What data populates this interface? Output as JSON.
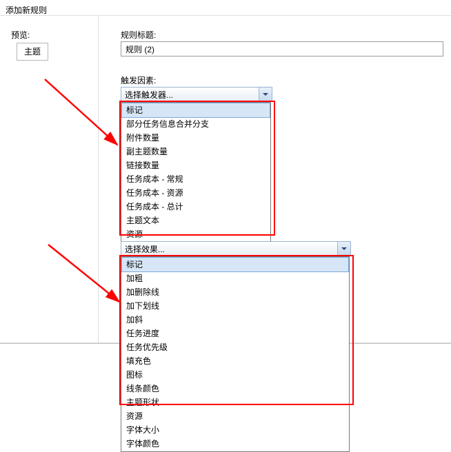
{
  "dialog_title": "添加新规则",
  "preview": {
    "label": "预览:",
    "text": "主题"
  },
  "rule_title": {
    "label": "规则标题:",
    "value": "规则 (2)"
  },
  "trigger": {
    "label": "触发因素:",
    "placeholder": "选择触发器...",
    "options": [
      "标记",
      "部分任务信息合并分支",
      "附件数量",
      "副主题数量",
      "链接数量",
      "任务成本 - 常规",
      "任务成本 - 资源",
      "任务成本 - 总计",
      "主题文本",
      "资源"
    ],
    "highlighted": 0
  },
  "effect": {
    "placeholder": "选择效果...",
    "options": [
      "标记",
      "加粗",
      "加删除线",
      "加下划线",
      "加斜",
      "任务进度",
      "任务优先级",
      "填充色",
      "图标",
      "线条颜色",
      "主题形状",
      "资源",
      "字体大小",
      "字体颜色"
    ],
    "highlighted": 0
  }
}
